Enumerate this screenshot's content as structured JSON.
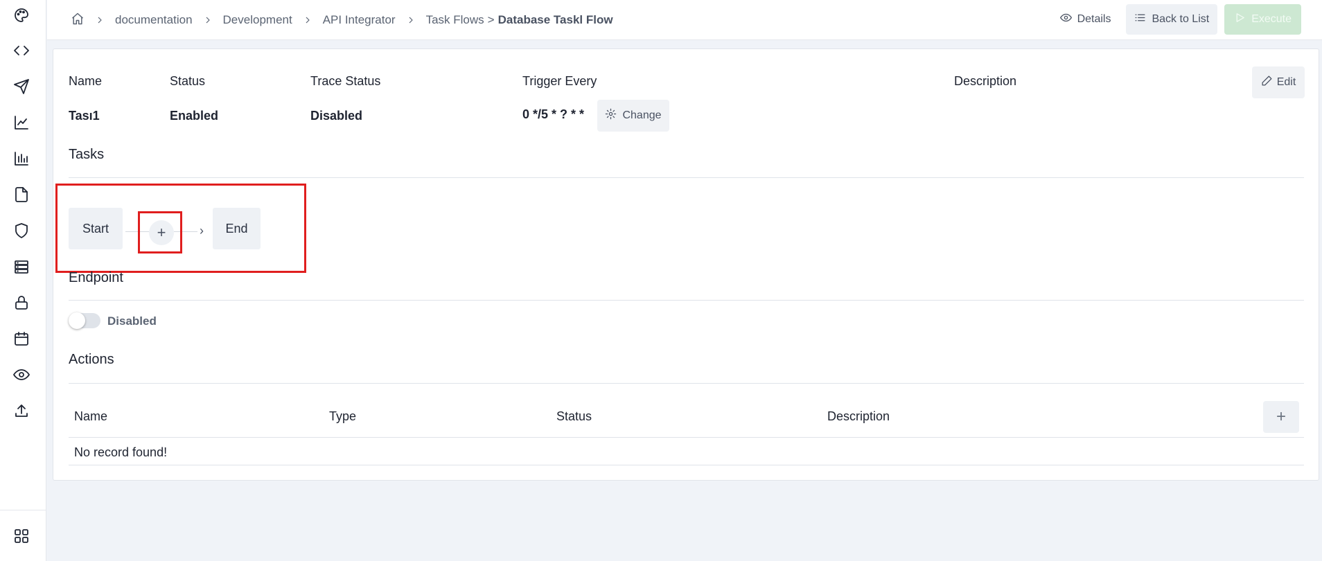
{
  "breadcrumb": {
    "items": [
      "documentation",
      "Development",
      "API Integrator",
      "Task Flows"
    ],
    "separator_last": ">",
    "current": "Database Taskl Flow"
  },
  "toolbar": {
    "details_label": "Details",
    "back_label": "Back to List",
    "execute_label": "Execute"
  },
  "info": {
    "name_label": "Name",
    "name_value": "Tası1",
    "status_label": "Status",
    "status_value": "Enabled",
    "trace_label": "Trace Status",
    "trace_value": "Disabled",
    "trigger_label": "Trigger Every",
    "trigger_value": "0 */5 * ? * *",
    "change_label": "Change",
    "description_label": "Description",
    "edit_label": "Edit"
  },
  "tasks": {
    "title": "Tasks",
    "start_label": "Start",
    "add_symbol": "+",
    "end_label": "End"
  },
  "endpoint": {
    "title": "Endpoint",
    "toggle_label": "Disabled",
    "enabled": false
  },
  "actions": {
    "title": "Actions",
    "columns": [
      "Name",
      "Type",
      "Status",
      "Description"
    ],
    "add_symbol": "+",
    "empty_text": "No record found!"
  },
  "colors": {
    "highlight": "#e01e1e",
    "execute_disabled": "#cde8d2"
  }
}
